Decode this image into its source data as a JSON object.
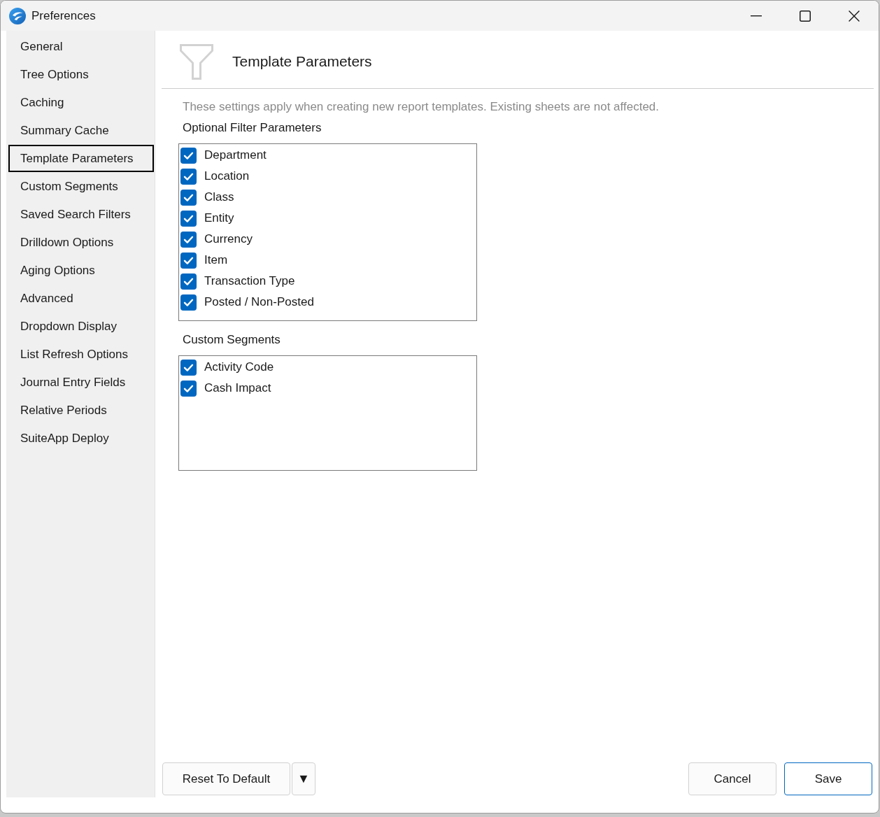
{
  "window": {
    "title": "Preferences"
  },
  "sidebar": {
    "items": [
      {
        "label": "General",
        "selected": false
      },
      {
        "label": "Tree Options",
        "selected": false
      },
      {
        "label": "Caching",
        "selected": false
      },
      {
        "label": "Summary Cache",
        "selected": false
      },
      {
        "label": "Template Parameters",
        "selected": true
      },
      {
        "label": "Custom Segments",
        "selected": false
      },
      {
        "label": "Saved Search Filters",
        "selected": false
      },
      {
        "label": "Drilldown Options",
        "selected": false
      },
      {
        "label": "Aging Options",
        "selected": false
      },
      {
        "label": "Advanced",
        "selected": false
      },
      {
        "label": "Dropdown Display",
        "selected": false
      },
      {
        "label": "List Refresh Options",
        "selected": false
      },
      {
        "label": "Journal Entry Fields",
        "selected": false
      },
      {
        "label": "Relative Periods",
        "selected": false
      },
      {
        "label": "SuiteApp Deploy",
        "selected": false
      }
    ]
  },
  "page": {
    "title": "Template Parameters",
    "description": "These settings apply when creating new report templates. Existing sheets are not affected."
  },
  "sections": [
    {
      "title": "Optional Filter Parameters",
      "items": [
        {
          "label": "Department",
          "checked": true
        },
        {
          "label": "Location",
          "checked": true
        },
        {
          "label": "Class",
          "checked": true
        },
        {
          "label": "Entity",
          "checked": true
        },
        {
          "label": "Currency",
          "checked": true
        },
        {
          "label": "Item",
          "checked": true
        },
        {
          "label": "Transaction Type",
          "checked": true
        },
        {
          "label": "Posted / Non-Posted",
          "checked": true
        }
      ]
    },
    {
      "title": "Custom Segments",
      "items": [
        {
          "label": "Activity Code",
          "checked": true
        },
        {
          "label": "Cash Impact",
          "checked": true
        }
      ]
    }
  ],
  "footer": {
    "reset_button": {
      "label": "Reset To Default",
      "default": false
    },
    "menu_button": {
      "label": "▼",
      "default": false
    },
    "cancel_button": {
      "label": "Cancel",
      "default": false
    },
    "save_button": {
      "label": "Save",
      "default": true
    }
  }
}
